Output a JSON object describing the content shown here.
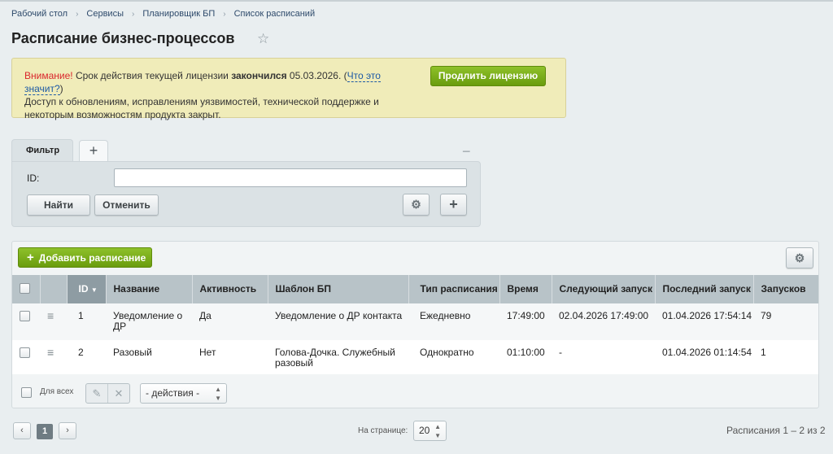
{
  "breadcrumbs": [
    "Рабочий стол",
    "Сервисы",
    "Планировщик БП",
    "Список расписаний"
  ],
  "page_title": "Расписание бизнес-процессов",
  "notice": {
    "warn": "Внимание!",
    "text1": " Срок действия текущей лицензии ",
    "bold": "закончился",
    "text2": " 05.03.2026. (",
    "link": "Что это значит?",
    "text3": ")",
    "line2": "Доступ к обновлениям, исправлениям уязвимостей, технической поддержке и",
    "line3": "некоторым возможностям продукта закрыт.",
    "button": "Продлить лицензию"
  },
  "filter": {
    "tab": "Фильтр",
    "id_label": "ID:",
    "id_value": "",
    "find": "Найти",
    "cancel": "Отменить"
  },
  "grid": {
    "add_button": "Добавить расписание",
    "columns": {
      "id": "ID",
      "name": "Название",
      "active": "Активность",
      "template": "Шаблон БП",
      "type": "Тип расписания",
      "time": "Время",
      "next": "Следующий запуск",
      "last": "Последний запуск",
      "runs": "Запусков"
    },
    "rows": [
      {
        "id": "1",
        "name": "Уведомление о ДР",
        "active": "Да",
        "template": "Уведомление о ДР контакта",
        "type": "Ежедневно",
        "time": "17:49:00",
        "next": "02.04.2026 17:49:00",
        "last": "01.04.2026 17:54:14",
        "runs": "79"
      },
      {
        "id": "2",
        "name": "Разовый",
        "active": "Нет",
        "template": "Голова-Дочка. Служебный разовый",
        "type": "Однократно",
        "time": "01:10:00",
        "next": "-",
        "last": "01.04.2026 01:14:54",
        "runs": "1"
      }
    ],
    "for_all": "Для всех",
    "actions": "- действия -"
  },
  "pager": {
    "current": "1",
    "per_page_label": "На странице:",
    "per_page": "20",
    "total": "Расписания 1 – 2 из 2"
  }
}
